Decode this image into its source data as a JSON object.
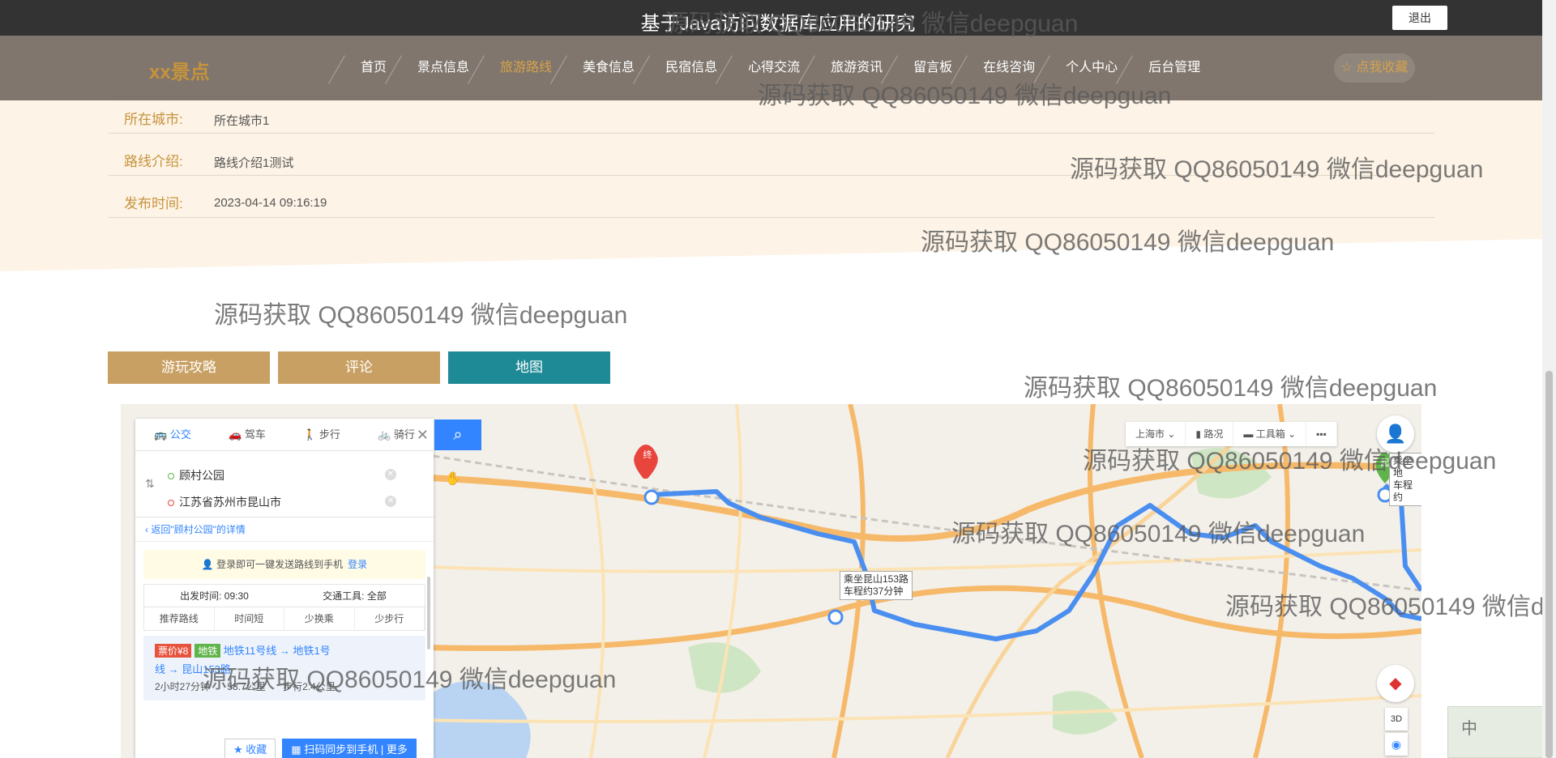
{
  "header": {
    "title": "基于Java访问数据库应用的研究",
    "logout_label": "退出"
  },
  "nav": {
    "brand": "xx景点",
    "items": [
      {
        "label": "首页",
        "active": false
      },
      {
        "label": "景点信息",
        "active": false
      },
      {
        "label": "旅游路线",
        "active": true
      },
      {
        "label": "美食信息",
        "active": false
      },
      {
        "label": "民宿信息",
        "active": false
      },
      {
        "label": "心得交流",
        "active": false
      },
      {
        "label": "旅游资讯",
        "active": false
      },
      {
        "label": "留言板",
        "active": false
      },
      {
        "label": "在线咨询",
        "active": false
      },
      {
        "label": "个人中心",
        "active": false
      },
      {
        "label": "后台管理",
        "active": false
      }
    ],
    "favorite_label": "☆ 点我收藏"
  },
  "detail": {
    "fields": [
      {
        "label": "所在城市:",
        "value": "所在城市1"
      },
      {
        "label": "路线介绍:",
        "value": "路线介绍1测试"
      },
      {
        "label": "发布时间:",
        "value": "2023-04-14 09:16:19"
      }
    ]
  },
  "tabs": [
    {
      "label": "游玩攻略",
      "color": "#c9a063"
    },
    {
      "label": "评论",
      "color": "#c9a063"
    },
    {
      "label": "地图",
      "color": "#1e8a96"
    }
  ],
  "map": {
    "modes": [
      "公交",
      "驾车",
      "步行",
      "骑行"
    ],
    "origin": "顾村公园",
    "destination": "江苏省苏州市昆山市",
    "back_link": "返回\"顾村公园\"的详情",
    "login_tip": "登录即可一键发送路线到手机",
    "login_link": "登录",
    "depart_time_label": "出发时间: 09:30",
    "transport_label": "交通工具: 全部",
    "sort_options": [
      "推荐路线",
      "时间短",
      "少换乘",
      "少步行"
    ],
    "route": {
      "price": "票价¥8",
      "tag": "地铁",
      "line1": "地铁11号线 → 地铁1号",
      "line2": "线 → 昆山153路",
      "duration": "2小时27分钟",
      "distance": "58.7公里",
      "walk": "步行2.4公里"
    },
    "actions": {
      "collect": "收藏",
      "sync": "扫码同步到手机",
      "more": "更多"
    },
    "toolbar": [
      "上海市",
      "路况",
      "工具箱"
    ],
    "bus_label_line1": "乘坐昆山153路",
    "bus_label_line2": "车程约37分钟",
    "right_label_line1": "乘坐地",
    "right_label_line2": "车程约",
    "end_marker": "终",
    "start_marker": "起",
    "btn_3d": "3D"
  },
  "watermark": "源码获取 QQ86050149 微信deepguan",
  "watermark_partial": "源码获取 QQ86050149 微信d",
  "ime": "中"
}
